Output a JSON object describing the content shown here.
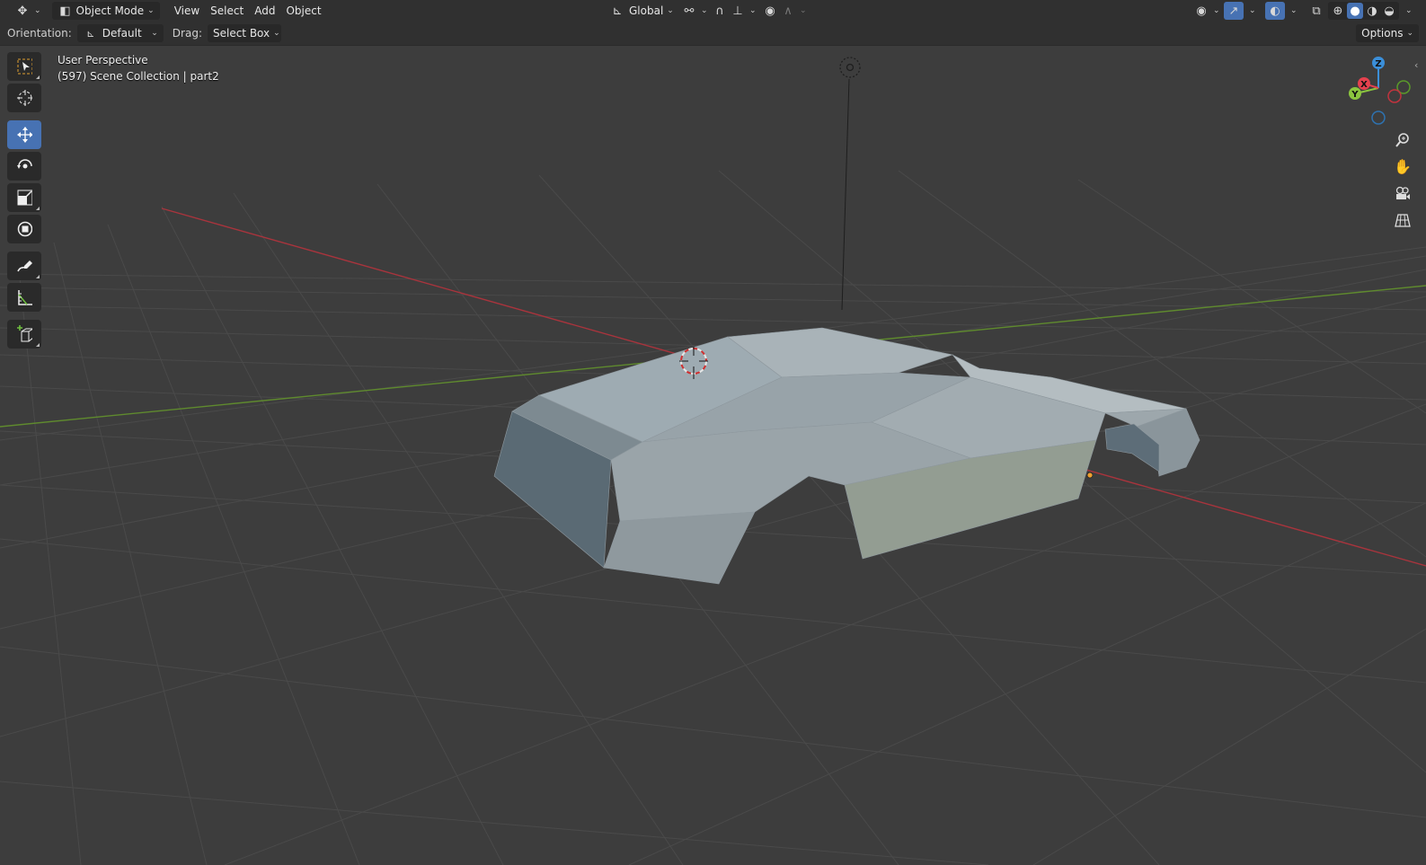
{
  "header": {
    "editor_type_icon": "transform-gizmo-icon",
    "mode_label": "Object Mode",
    "menus": [
      "View",
      "Select",
      "Add",
      "Object"
    ],
    "transform_orientation": "Global",
    "icons": [
      "pivot-icon",
      "snap-magnet-icon",
      "snap-increment-icon",
      "proportional-edit-icon",
      "falloff-icon",
      "visibility-eye-icon",
      "gizmo-icon",
      "overlay-icon",
      "xray-icon",
      "wireframe-shading-icon",
      "solid-shading-icon",
      "material-shading-icon",
      "rendered-shading-icon"
    ]
  },
  "tool_settings": {
    "orientation_label": "Orientation:",
    "orientation_value": "Default",
    "drag_label": "Drag:",
    "drag_value": "Select Box",
    "options_label": "Options"
  },
  "viewport": {
    "view_name": "User Perspective",
    "collection_info": "(597) Scene Collection | part2"
  },
  "toolbar": {
    "tools": [
      "select-box-icon",
      "cursor-icon",
      "move-icon",
      "rotate-icon",
      "scale-icon",
      "transform-icon",
      "annotate-icon",
      "measure-icon",
      "add-cube-icon"
    ],
    "active": "move-icon"
  },
  "navigation_gizmo": {
    "axes": [
      "X",
      "Y",
      "Z"
    ],
    "colors": {
      "x": "#e5414e",
      "y": "#8bc53f",
      "z": "#3b8fd9"
    }
  },
  "colors": {
    "accent": "#4772b3",
    "viewport_bg": "#3d3d3d",
    "header_bg": "#303030",
    "x_axis": "#a8343d",
    "y_axis": "#5f8a2e"
  }
}
